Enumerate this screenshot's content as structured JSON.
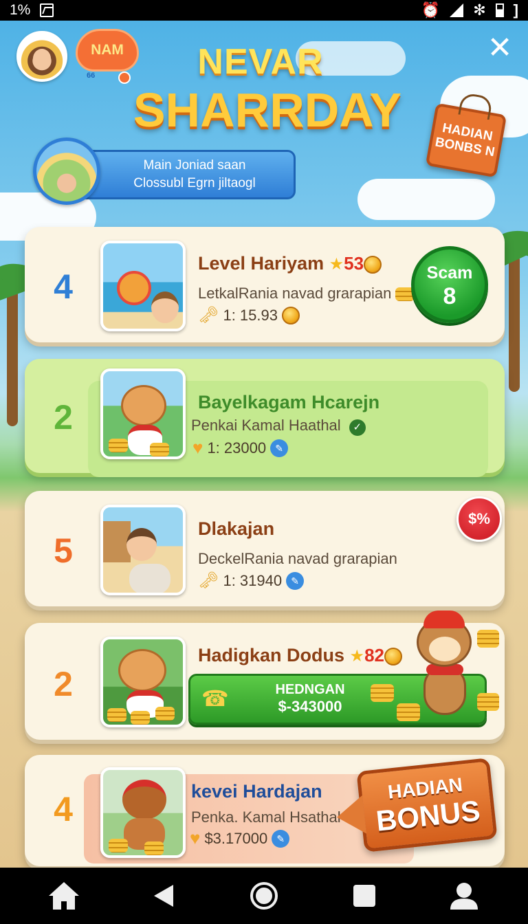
{
  "status_bar": {
    "battery_text": "1%"
  },
  "header": {
    "badge_text": "NAM",
    "badge_deco": "66",
    "title_line1": "NEVAR",
    "title_line2": "SHARRDAY",
    "close_label": "✕",
    "bonus_sign": "HADIAN BONBS N",
    "promo_line1": "Main Joniad saan",
    "promo_line2": "Clossubl Egrn jiltaogl"
  },
  "list": [
    {
      "rank": "4",
      "rank_color": "#2f7fd6",
      "title": "Level Hariyam",
      "points": "53",
      "subtitle": "LetkalRania navad grarapian",
      "value": "1: 15.93",
      "button_l1": "Scam",
      "button_l2": "8"
    },
    {
      "rank": "2",
      "rank_color": "#5fb53a",
      "title": "Bayelkagam Hcarejn",
      "subtitle": "Penkai Kamal Haathal",
      "value": "1: 23000"
    },
    {
      "rank": "5",
      "rank_color": "#ef6d2a",
      "title": "Dlakajan",
      "subtitle": "DeckelRania navad grarapian",
      "value": "1: 31940",
      "badge": "$%"
    },
    {
      "rank": "2",
      "rank_color": "#f08a2a",
      "title": "Hadigkan Dodus",
      "points": "82",
      "button_l1": "HEDNGAN",
      "button_l2": "$-343000"
    },
    {
      "rank": "4",
      "rank_color": "#f29a1f",
      "title": "kevei Hardajan",
      "subtitle": "Penka. Kamal Hsathal",
      "value": "$3.17000",
      "banner_l1": "HADIAN",
      "banner_l2": "BONUS"
    }
  ],
  "nav": [
    "home-icon",
    "back-icon",
    "circle-home-icon",
    "square-recents-icon",
    "profile-icon"
  ]
}
